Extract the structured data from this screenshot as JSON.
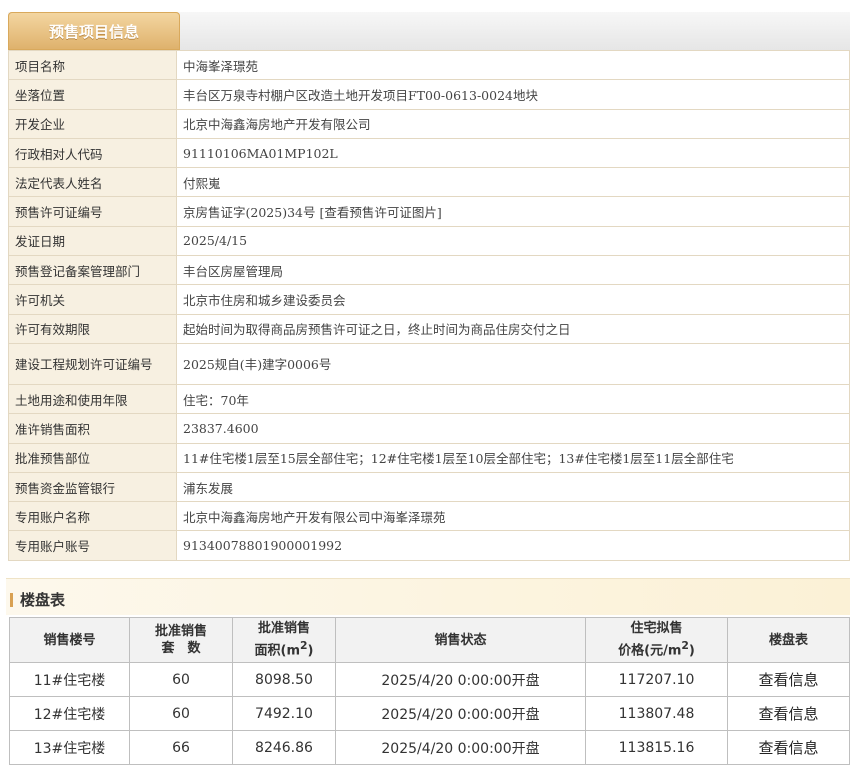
{
  "header": {
    "tab_label": "预售项目信息"
  },
  "info_rows": [
    {
      "label": "项目名称",
      "value": "中海峯泽璟苑"
    },
    {
      "label": "坐落位置",
      "value": "丰台区万泉寺村棚户区改造土地开发项目FT00-0613-0024地块"
    },
    {
      "label": "开发企业",
      "value": "北京中海鑫海房地产开发有限公司"
    },
    {
      "label": "行政相对人代码",
      "value": "91110106MA01MP102L"
    },
    {
      "label": "法定代表人姓名",
      "value": "付熙嵬"
    },
    {
      "label": "预售许可证编号",
      "value": "京房售证字(2025)34号 [查看预售许可证图片]"
    },
    {
      "label": "发证日期",
      "value": "2025/4/15"
    },
    {
      "label": "预售登记备案管理部门",
      "value": "丰台区房屋管理局"
    },
    {
      "label": "许可机关",
      "value": "北京市住房和城乡建设委员会"
    },
    {
      "label": "许可有效期限",
      "value": "起始时间为取得商品房预售许可证之日，终止时间为商品住房交付之日"
    },
    {
      "label": "建设工程规划许可证编号",
      "value": "2025规自(丰)建字0006号"
    },
    {
      "label": "土地用途和使用年限",
      "value": "住宅：70年"
    },
    {
      "label": "准许销售面积",
      "value": "23837.4600"
    },
    {
      "label": "批准预售部位",
      "value": "11#住宅楼1层至15层全部住宅；12#住宅楼1层至10层全部住宅；13#住宅楼1层至11层全部住宅"
    },
    {
      "label": "预售资金监管银行",
      "value": "浦东发展"
    },
    {
      "label": "专用账户名称",
      "value": "北京中海鑫海房地产开发有限公司中海峯泽璟苑"
    },
    {
      "label": "专用账户账号",
      "value": "91340078801900001992"
    }
  ],
  "building": {
    "title": "楼盘表",
    "headers": {
      "building_no": "销售楼号",
      "approved_units_line1": "批准销售",
      "approved_units_line2": "套　数",
      "approved_area_line1": "批准销售",
      "approved_area_line2": "面积(m",
      "area_sup": "2",
      "area_close": ")",
      "status": "销售状态",
      "price_line1": "住宅拟售",
      "price_line2": "价格(元/m",
      "price_sup": "2",
      "price_close": ")",
      "table": "楼盘表"
    },
    "rows": [
      {
        "building_no": "11#住宅楼",
        "units": "60",
        "area": "8098.50",
        "status": "2025/4/20 0:00:00开盘",
        "price": "117207.10",
        "link": "查看信息"
      },
      {
        "building_no": "12#住宅楼",
        "units": "60",
        "area": "7492.10",
        "status": "2025/4/20 0:00:00开盘",
        "price": "113807.48",
        "link": "查看信息"
      },
      {
        "building_no": "13#住宅楼",
        "units": "66",
        "area": "8246.86",
        "status": "2025/4/20 0:00:00开盘",
        "price": "113815.16",
        "link": "查看信息"
      }
    ]
  }
}
